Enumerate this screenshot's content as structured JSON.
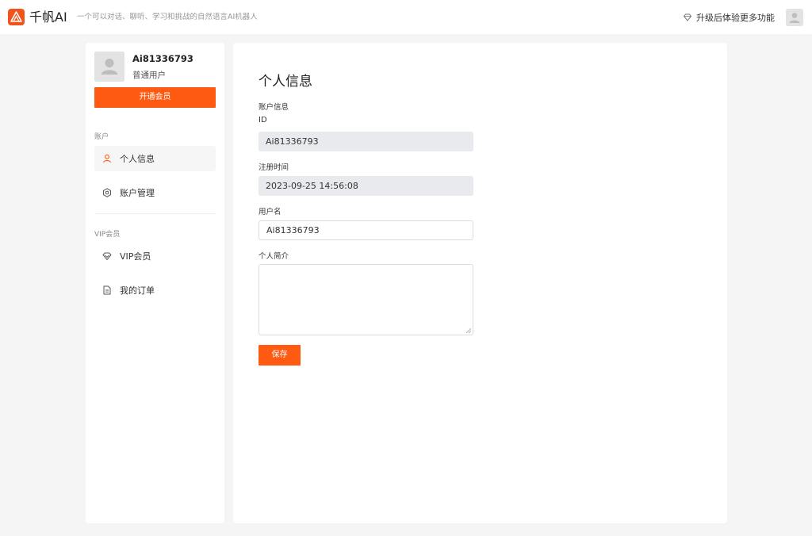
{
  "header": {
    "logo_icon": "sail-logo-icon",
    "brand": "千帆AI",
    "slogan": "一个可以对话、聊听、学习和挑战的自然语言AI机器人",
    "upgrade_icon": "diamond-icon",
    "upgrade_label": "升级后体验更多功能",
    "avatar_icon": "user-avatar-icon"
  },
  "sidebar": {
    "user": {
      "avatar_icon": "user-avatar-icon",
      "name": "Ai81336793",
      "level": "普通用户"
    },
    "vip_button": "开通会员",
    "sections": [
      {
        "label": "账户",
        "items": [
          {
            "label": "个人信息",
            "icon": "user-icon",
            "active": true
          },
          {
            "label": "账户管理",
            "icon": "gear-icon",
            "active": false
          }
        ]
      },
      {
        "label": "VIP会员",
        "items": [
          {
            "label": "VIP会员",
            "icon": "diamond-icon",
            "active": false
          },
          {
            "label": "我的订单",
            "icon": "document-icon",
            "active": false
          }
        ]
      }
    ]
  },
  "main": {
    "title": "个人信息",
    "section_label": "账户信息",
    "fields": {
      "id": {
        "label": "ID",
        "value": "Ai81336793"
      },
      "register_time": {
        "label": "注册时间",
        "value": "2023-09-25 14:56:08"
      },
      "username": {
        "label": "用户名",
        "value": "Ai81336793"
      },
      "bio": {
        "label": "个人简介",
        "value": ""
      }
    },
    "save_button": "保存"
  },
  "colors": {
    "accent": "#ff5a12",
    "logo": "#f0531c",
    "active_icon": "#ff5a12",
    "readonly_bg": "#e8eaed",
    "page_bg": "#f5f5f5"
  }
}
